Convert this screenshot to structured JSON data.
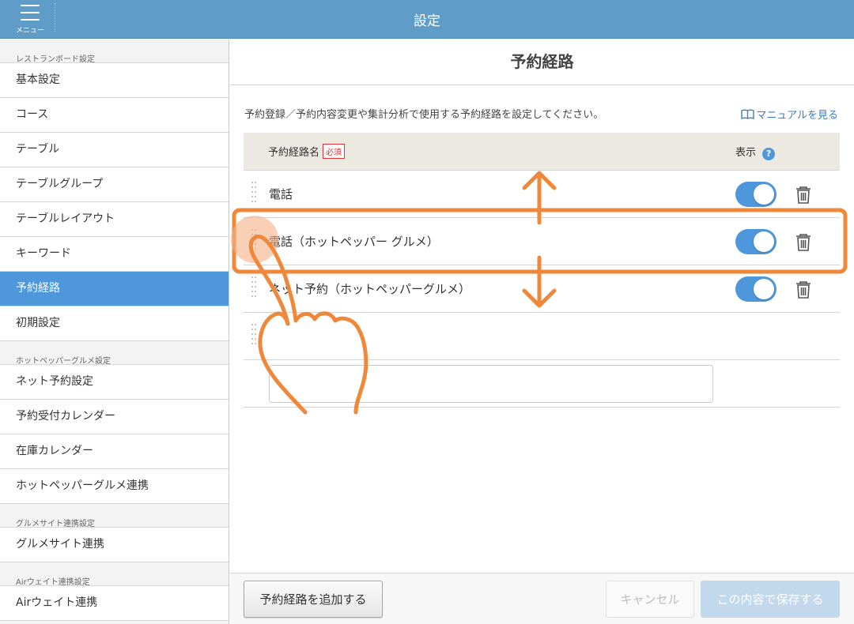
{
  "header": {
    "menu_label": "メニュー",
    "title": "設定"
  },
  "sidebar": {
    "sections": [
      {
        "title": "レストランボード設定",
        "items": [
          "基本設定",
          "コース",
          "テーブル",
          "テーブルグループ",
          "テーブルレイアウト",
          "キーワード",
          "予約経路",
          "初期設定"
        ]
      },
      {
        "title": "ホットペッパーグルメ設定",
        "items": [
          "ネット予約設定",
          "予約受付カレンダー",
          "在庫カレンダー",
          "ホットペッパーグルメ連携"
        ]
      },
      {
        "title": "グルメサイト連携設定",
        "items": [
          "グルメサイト連携"
        ]
      },
      {
        "title": "Airウェイト連携設定",
        "items": [
          "Airウェイト連携"
        ]
      }
    ],
    "active_item": "予約経路"
  },
  "main": {
    "title": "予約経路",
    "description": "予約登録／予約内容変更や集計分析で使用する予約経路を設定してください。",
    "manual_link": "マニュアルを見る",
    "table": {
      "col_name": "予約経路名",
      "required_badge": "必須",
      "col_show": "表示",
      "help_icon": "?",
      "rows": [
        {
          "name": "電話",
          "enabled": true
        },
        {
          "name": "電話（ホットペッパー グルメ）",
          "enabled": true
        },
        {
          "name": "ネット予約（ホットペッパーグルメ）",
          "enabled": true
        }
      ],
      "new_input_value": ""
    }
  },
  "footer": {
    "add_button": "予約経路を追加する",
    "cancel_button": "キャンセル",
    "save_button": "この内容で保存する"
  },
  "colors": {
    "header": "#5f9cc8",
    "accent": "#4e97db",
    "annotation": "#f0883c"
  },
  "icons": {
    "drag": "drag-handle-icon",
    "delete": "trash-icon",
    "manual": "book-icon",
    "gesture": "hand-pointer-icon"
  }
}
